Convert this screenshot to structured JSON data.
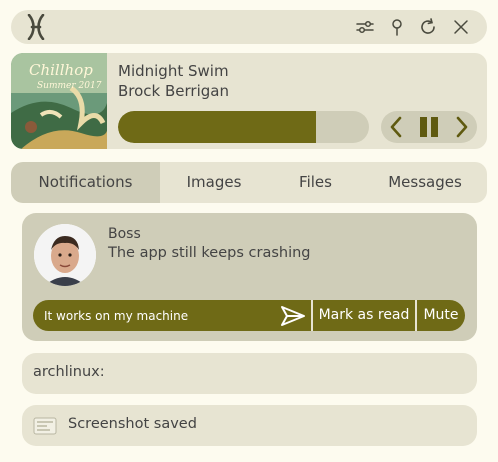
{
  "topbar": {
    "logo_icon": "arch-x-logo",
    "icons": [
      "sliders-icon",
      "pin-icon",
      "refresh-icon",
      "close-icon"
    ]
  },
  "player": {
    "title": "Midnight Swim",
    "artist": "Brock Berrigan",
    "cover_art": {
      "text_line1": "Chillhop",
      "text_line2": "Summer 2017"
    },
    "progress": 0.79,
    "controls": [
      "previous-icon",
      "pause-icon",
      "next-icon"
    ]
  },
  "tabs": [
    {
      "label": "Notifications",
      "active": true
    },
    {
      "label": "Images",
      "active": false
    },
    {
      "label": "Files",
      "active": false
    },
    {
      "label": "Messages",
      "active": false
    }
  ],
  "notification": {
    "sender": "Boss",
    "body": "The app still keeps crashing",
    "reply_value": "It works on my machine",
    "actions": {
      "mark_read": "Mark as read",
      "mute": "Mute"
    }
  },
  "cards": [
    {
      "text": "archlinux:"
    },
    {
      "text": "Screenshot saved",
      "icon": "screenshot-thumbnail"
    }
  ],
  "colors": {
    "accent": "#6f6a16",
    "panel": "#e7e4d2",
    "panel_dark": "#cfcdb8",
    "background": "#fdfbef"
  }
}
